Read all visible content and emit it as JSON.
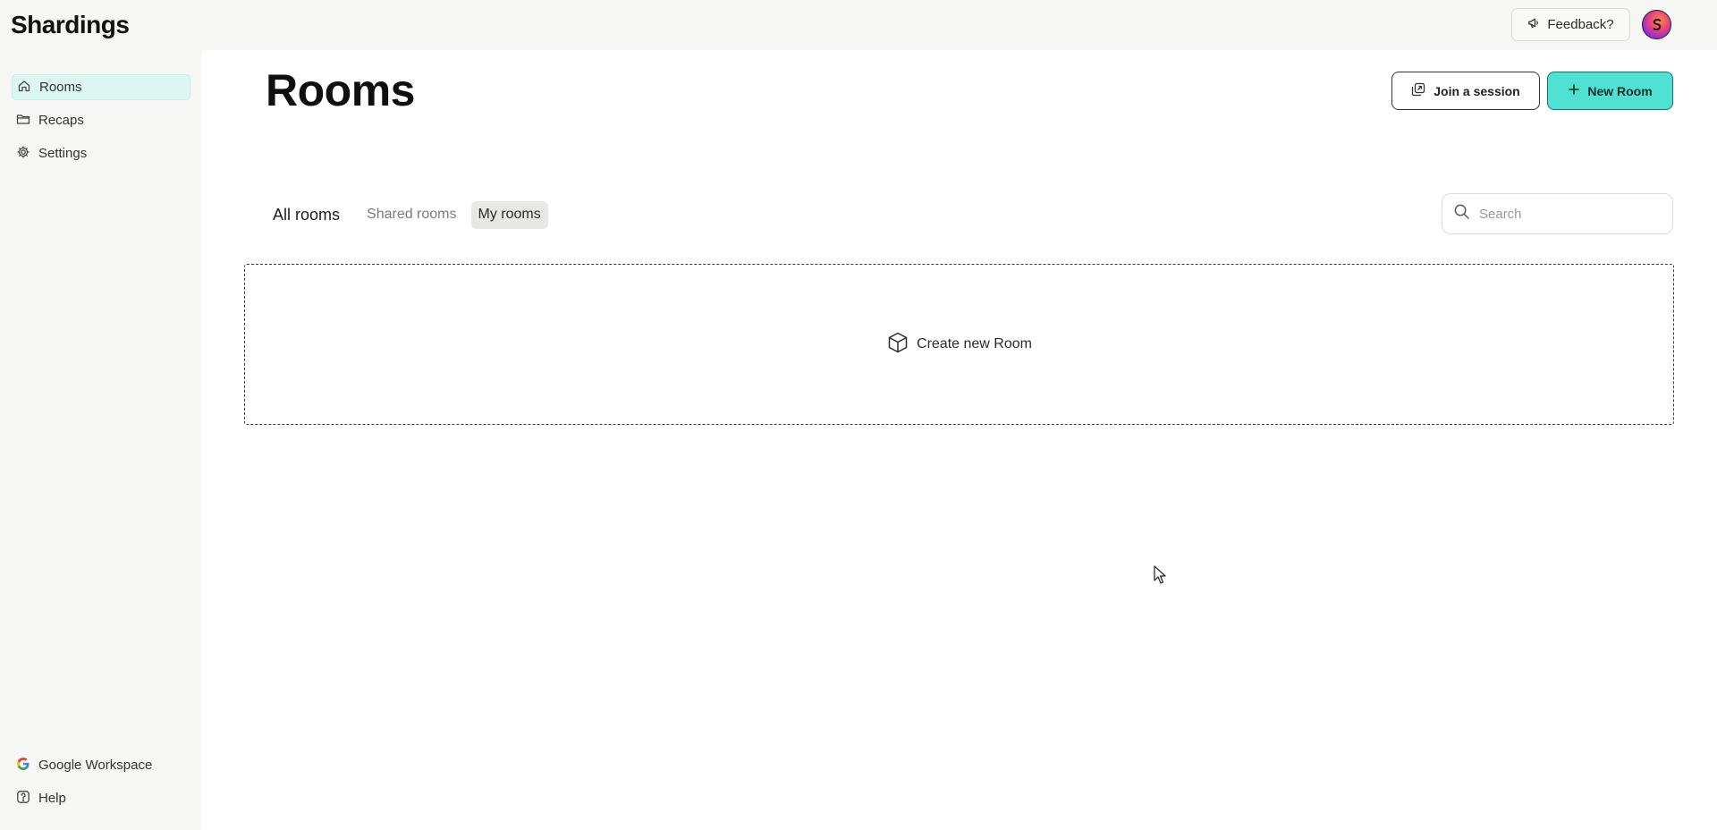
{
  "app": {
    "brand": "Shardings"
  },
  "header": {
    "feedback_label": "Feedback?"
  },
  "sidebar": {
    "items": [
      {
        "label": "Rooms",
        "icon": "home-icon",
        "active": true
      },
      {
        "label": "Recaps",
        "icon": "folder-icon"
      },
      {
        "label": "Settings",
        "icon": "gear-icon"
      }
    ],
    "bottom_items": [
      {
        "label": "Google Workspace",
        "icon": "google-icon"
      },
      {
        "label": "Help",
        "icon": "help-icon"
      }
    ]
  },
  "main": {
    "title": "Rooms",
    "join_label": "Join a session",
    "new_room_label": "New Room",
    "tabs": [
      {
        "label": "All rooms"
      },
      {
        "label": "Shared rooms"
      },
      {
        "label": "My rooms",
        "selected": true
      }
    ],
    "search": {
      "placeholder": "Search",
      "value": ""
    },
    "create_label": "Create new Room"
  },
  "colors": {
    "accent": "#4fe2d2",
    "active_nav": "#dcf7f2",
    "sidebar_bg": "#f6f6f4"
  }
}
